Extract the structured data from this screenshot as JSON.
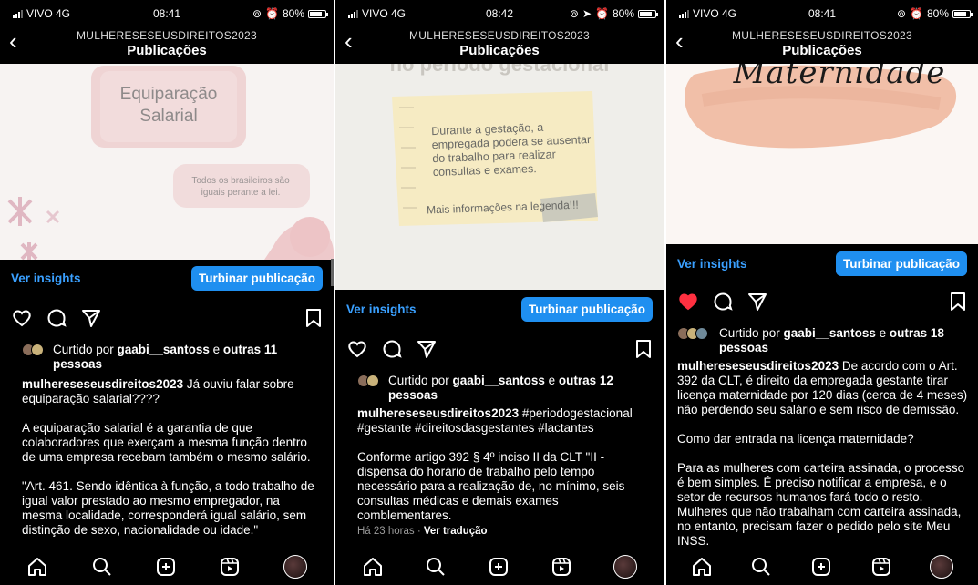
{
  "phones": [
    {
      "status": {
        "carrier": "VIVO  4G",
        "time": "08:41",
        "battery": "80%"
      },
      "header": {
        "account": "MULHERESESEUSDIREITOS2023",
        "title": "Publicações"
      },
      "image": {
        "title": "Equiparação Salarial",
        "subtitle": "Todos os brasileiros são iguais perante a lei."
      },
      "insights_label": "Ver insights",
      "boost_label": "Turbinar publicação",
      "liked": {
        "prefix": "Curtido por ",
        "user": "gaabi__santoss",
        "mid": " e ",
        "others": "outras 11 pessoas"
      },
      "caption": {
        "user": "mulhereseseusdireitos2023",
        "text": " Já ouviu falar sobre equiparação salarial????",
        "p2": "A equiparação salarial é a garantia de que colaboradores que exerçam a mesma função dentro de uma empresa recebam também o mesmo salário.",
        "p3": "\"Art. 461. Sendo idêntica à função, a todo trabalho de igual valor prestado ao mesmo empregador, na mesma localidade, corresponderá igual salário, sem distinção de sexo, nacionalidade ou idade.\""
      }
    },
    {
      "status": {
        "carrier": "VIVO  4G",
        "time": "08:42",
        "battery": "80%"
      },
      "header": {
        "account": "MULHERESESEUSDIREITOS2023",
        "title": "Publicações"
      },
      "image": {
        "top_text": "no período gestacional",
        "note": "Durante a gestação, a empregada podera se ausentar do trabalho para realizar consultas e exames.",
        "more": "Mais informações na legenda!!!"
      },
      "insights_label": "Ver insights",
      "boost_label": "Turbinar publicação",
      "liked": {
        "prefix": "Curtido por ",
        "user": "gaabi__santoss",
        "mid": " e ",
        "others": "outras 12 pessoas"
      },
      "caption": {
        "user": "mulhereseseusdireitos2023",
        "text": " #periodogestacional #gestante #direitosdasgestantes #lactantes",
        "p2": "Conforme artigo 392 § 4º inciso II da CLT \"II - dispensa do horário de trabalho pelo tempo necessário para a realização de, no mínimo, seis consultas médicas e demais exames comblementares."
      },
      "meta": {
        "time": "Há 23 horas · ",
        "translate": "Ver tradução"
      }
    },
    {
      "status": {
        "carrier": "VIVO  4G",
        "time": "08:41",
        "battery": "80%"
      },
      "header": {
        "account": "MULHERESESEUSDIREITOS2023",
        "title": "Publicações"
      },
      "image": {
        "script": "Maternidade"
      },
      "insights_label": "Ver insights",
      "boost_label": "Turbinar publicação",
      "liked": {
        "prefix": "Curtido por ",
        "user": "gaabi__santoss",
        "mid": " e ",
        "others": "outras 18 pessoas"
      },
      "caption": {
        "user": "mulhereseseusdireitos2023",
        "text": " De acordo com o Art. 392 da CLT, é direito da empregada gestante tirar licença maternidade por 120 dias (cerca de 4 meses) não perdendo seu salário e sem risco de demissão.",
        "p2": "Como dar entrada na licença maternidade?",
        "p3": "Para as mulheres com carteira assinada, o processo é bem simples. É preciso notificar a empresa, e o setor de recursos humanos fará todo o resto. Mulheres que não trabalham com carteira assinada, no entanto, precisam fazer o pedido pelo site Meu INSS."
      }
    }
  ],
  "colors": {
    "accent": "#1f8ff0",
    "link": "#3aa0ff",
    "heart": "#ff3040"
  }
}
